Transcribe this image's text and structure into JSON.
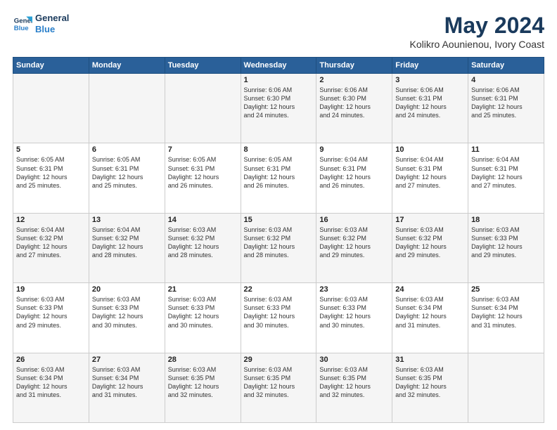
{
  "header": {
    "logo_line1": "General",
    "logo_line2": "Blue",
    "title": "May 2024",
    "subtitle": "Kolikro Aounienou, Ivory Coast"
  },
  "days_of_week": [
    "Sunday",
    "Monday",
    "Tuesday",
    "Wednesday",
    "Thursday",
    "Friday",
    "Saturday"
  ],
  "weeks": [
    [
      {
        "day": "",
        "text": ""
      },
      {
        "day": "",
        "text": ""
      },
      {
        "day": "",
        "text": ""
      },
      {
        "day": "1",
        "text": "Sunrise: 6:06 AM\nSunset: 6:30 PM\nDaylight: 12 hours\nand 24 minutes."
      },
      {
        "day": "2",
        "text": "Sunrise: 6:06 AM\nSunset: 6:30 PM\nDaylight: 12 hours\nand 24 minutes."
      },
      {
        "day": "3",
        "text": "Sunrise: 6:06 AM\nSunset: 6:31 PM\nDaylight: 12 hours\nand 24 minutes."
      },
      {
        "day": "4",
        "text": "Sunrise: 6:06 AM\nSunset: 6:31 PM\nDaylight: 12 hours\nand 25 minutes."
      }
    ],
    [
      {
        "day": "5",
        "text": "Sunrise: 6:05 AM\nSunset: 6:31 PM\nDaylight: 12 hours\nand 25 minutes."
      },
      {
        "day": "6",
        "text": "Sunrise: 6:05 AM\nSunset: 6:31 PM\nDaylight: 12 hours\nand 25 minutes."
      },
      {
        "day": "7",
        "text": "Sunrise: 6:05 AM\nSunset: 6:31 PM\nDaylight: 12 hours\nand 26 minutes."
      },
      {
        "day": "8",
        "text": "Sunrise: 6:05 AM\nSunset: 6:31 PM\nDaylight: 12 hours\nand 26 minutes."
      },
      {
        "day": "9",
        "text": "Sunrise: 6:04 AM\nSunset: 6:31 PM\nDaylight: 12 hours\nand 26 minutes."
      },
      {
        "day": "10",
        "text": "Sunrise: 6:04 AM\nSunset: 6:31 PM\nDaylight: 12 hours\nand 27 minutes."
      },
      {
        "day": "11",
        "text": "Sunrise: 6:04 AM\nSunset: 6:31 PM\nDaylight: 12 hours\nand 27 minutes."
      }
    ],
    [
      {
        "day": "12",
        "text": "Sunrise: 6:04 AM\nSunset: 6:32 PM\nDaylight: 12 hours\nand 27 minutes."
      },
      {
        "day": "13",
        "text": "Sunrise: 6:04 AM\nSunset: 6:32 PM\nDaylight: 12 hours\nand 28 minutes."
      },
      {
        "day": "14",
        "text": "Sunrise: 6:03 AM\nSunset: 6:32 PM\nDaylight: 12 hours\nand 28 minutes."
      },
      {
        "day": "15",
        "text": "Sunrise: 6:03 AM\nSunset: 6:32 PM\nDaylight: 12 hours\nand 28 minutes."
      },
      {
        "day": "16",
        "text": "Sunrise: 6:03 AM\nSunset: 6:32 PM\nDaylight: 12 hours\nand 29 minutes."
      },
      {
        "day": "17",
        "text": "Sunrise: 6:03 AM\nSunset: 6:32 PM\nDaylight: 12 hours\nand 29 minutes."
      },
      {
        "day": "18",
        "text": "Sunrise: 6:03 AM\nSunset: 6:33 PM\nDaylight: 12 hours\nand 29 minutes."
      }
    ],
    [
      {
        "day": "19",
        "text": "Sunrise: 6:03 AM\nSunset: 6:33 PM\nDaylight: 12 hours\nand 29 minutes."
      },
      {
        "day": "20",
        "text": "Sunrise: 6:03 AM\nSunset: 6:33 PM\nDaylight: 12 hours\nand 30 minutes."
      },
      {
        "day": "21",
        "text": "Sunrise: 6:03 AM\nSunset: 6:33 PM\nDaylight: 12 hours\nand 30 minutes."
      },
      {
        "day": "22",
        "text": "Sunrise: 6:03 AM\nSunset: 6:33 PM\nDaylight: 12 hours\nand 30 minutes."
      },
      {
        "day": "23",
        "text": "Sunrise: 6:03 AM\nSunset: 6:33 PM\nDaylight: 12 hours\nand 30 minutes."
      },
      {
        "day": "24",
        "text": "Sunrise: 6:03 AM\nSunset: 6:34 PM\nDaylight: 12 hours\nand 31 minutes."
      },
      {
        "day": "25",
        "text": "Sunrise: 6:03 AM\nSunset: 6:34 PM\nDaylight: 12 hours\nand 31 minutes."
      }
    ],
    [
      {
        "day": "26",
        "text": "Sunrise: 6:03 AM\nSunset: 6:34 PM\nDaylight: 12 hours\nand 31 minutes."
      },
      {
        "day": "27",
        "text": "Sunrise: 6:03 AM\nSunset: 6:34 PM\nDaylight: 12 hours\nand 31 minutes."
      },
      {
        "day": "28",
        "text": "Sunrise: 6:03 AM\nSunset: 6:35 PM\nDaylight: 12 hours\nand 32 minutes."
      },
      {
        "day": "29",
        "text": "Sunrise: 6:03 AM\nSunset: 6:35 PM\nDaylight: 12 hours\nand 32 minutes."
      },
      {
        "day": "30",
        "text": "Sunrise: 6:03 AM\nSunset: 6:35 PM\nDaylight: 12 hours\nand 32 minutes."
      },
      {
        "day": "31",
        "text": "Sunrise: 6:03 AM\nSunset: 6:35 PM\nDaylight: 12 hours\nand 32 minutes."
      },
      {
        "day": "",
        "text": ""
      }
    ]
  ]
}
